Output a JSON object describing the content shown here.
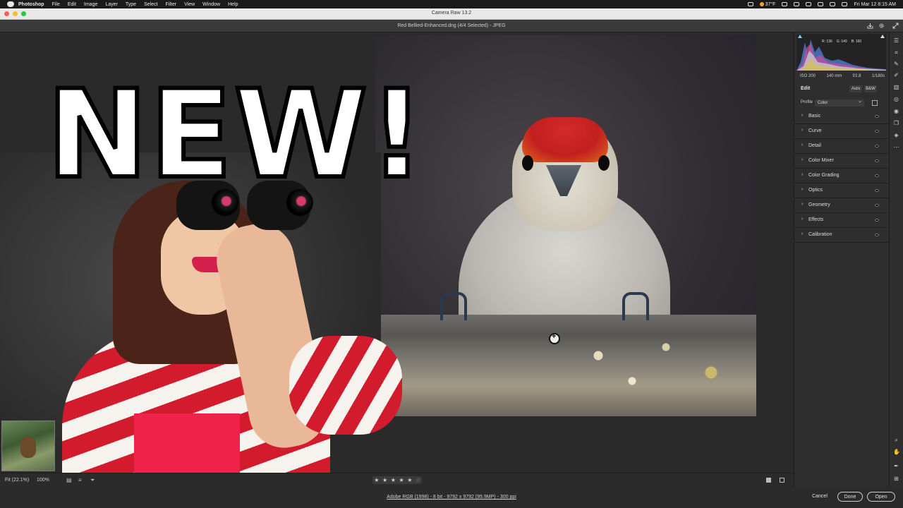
{
  "menubar": {
    "app": "Photoshop",
    "items": [
      "File",
      "Edit",
      "Image",
      "Layer",
      "Type",
      "Select",
      "Filter",
      "View",
      "Window",
      "Help"
    ],
    "temperature": "37°F",
    "datetime": "Fri Mar 12  8:15 AM"
  },
  "window": {
    "title": "Camera Raw 13.2"
  },
  "header": {
    "filename": "Red Bellied-Enhanced.dng (4/4 Selected)  -  JPEG"
  },
  "overlay": {
    "headline": "NEW!"
  },
  "statusbar": {
    "fit": "Fit (22.1%)",
    "zoom": "100%",
    "rating": [
      "★",
      "★",
      "★",
      "★",
      "★"
    ]
  },
  "footer": {
    "info": "Adobe RGB (1998) - 8 bit - 9792 x 9792 (95.9MP) - 300 ppi",
    "cancel": "Cancel",
    "done": "Done",
    "open": "Open"
  },
  "panel": {
    "rgb": {
      "r": "R: 136",
      "g": "G: 140",
      "b": "B: 160"
    },
    "exif": {
      "iso": "ISO 200",
      "focal": "140 mm",
      "aperture": "f/2.8",
      "shutter": "1/180s"
    },
    "edit_label": "Edit",
    "auto": "Auto",
    "bw": "B&W",
    "profile_label": "Profile",
    "profile_value": "Color",
    "sections": [
      "Basic",
      "Curve",
      "Detail",
      "Color Mixer",
      "Color Grading",
      "Optics",
      "Geometry",
      "Effects",
      "Calibration"
    ]
  },
  "icons": {
    "tools": [
      "edit-sliders-icon",
      "crop-icon",
      "healing-icon",
      "brush-icon",
      "gradient-icon",
      "radial-icon",
      "redeye-icon",
      "presets-icon",
      "snapshot-icon",
      "more-icon",
      "zoom-icon",
      "hand-icon",
      "sampler-icon",
      "grid-icon"
    ]
  }
}
